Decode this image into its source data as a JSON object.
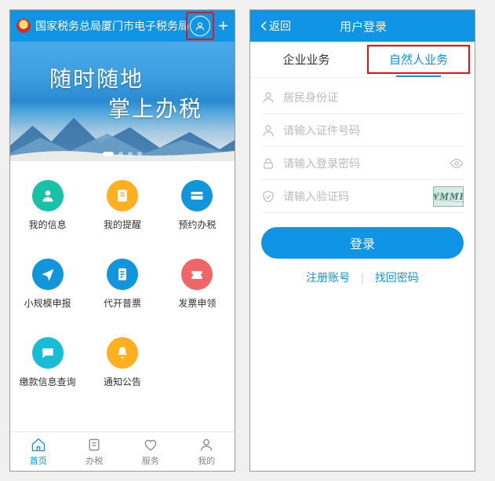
{
  "left": {
    "header_title": "国家税务总局厦门市电子税务局",
    "banner": {
      "line1": "随时随地",
      "line2": "掌上办税"
    },
    "grid": [
      {
        "label": "我的信息",
        "color": "#19c2a7",
        "icon": "user"
      },
      {
        "label": "我的提醒",
        "color": "#ffb020",
        "icon": "note"
      },
      {
        "label": "预约办税",
        "color": "#1296db",
        "icon": "card"
      },
      {
        "label": "小规模申报",
        "color": "#1296db",
        "icon": "plane"
      },
      {
        "label": "代开普票",
        "color": "#1296db",
        "icon": "doc"
      },
      {
        "label": "发票申领",
        "color": "#f06565",
        "icon": "ticket"
      },
      {
        "label": "缴款信息查询",
        "color": "#17bdd6",
        "icon": "chat"
      },
      {
        "label": "通知公告",
        "color": "#ffb020",
        "icon": "bell"
      }
    ],
    "tabs": [
      {
        "label": "首页",
        "icon": "home",
        "active": true
      },
      {
        "label": "办税",
        "icon": "list",
        "active": false
      },
      {
        "label": "服务",
        "icon": "heart",
        "active": false
      },
      {
        "label": "我的",
        "icon": "me",
        "active": false
      }
    ]
  },
  "right": {
    "back_label": "返回",
    "title": "用户登录",
    "tabs": {
      "enterprise": "企业业务",
      "individual": "自然人业务"
    },
    "fields": {
      "id_type_placeholder": "居民身份证",
      "id_number_placeholder": "请输入证件号码",
      "password_placeholder": "请输入登录密码",
      "captcha_placeholder": "请输入验证码"
    },
    "captcha_text": "WMMF",
    "login_button": "登录",
    "links": {
      "register": "注册账号",
      "forgot": "找回密码"
    }
  }
}
